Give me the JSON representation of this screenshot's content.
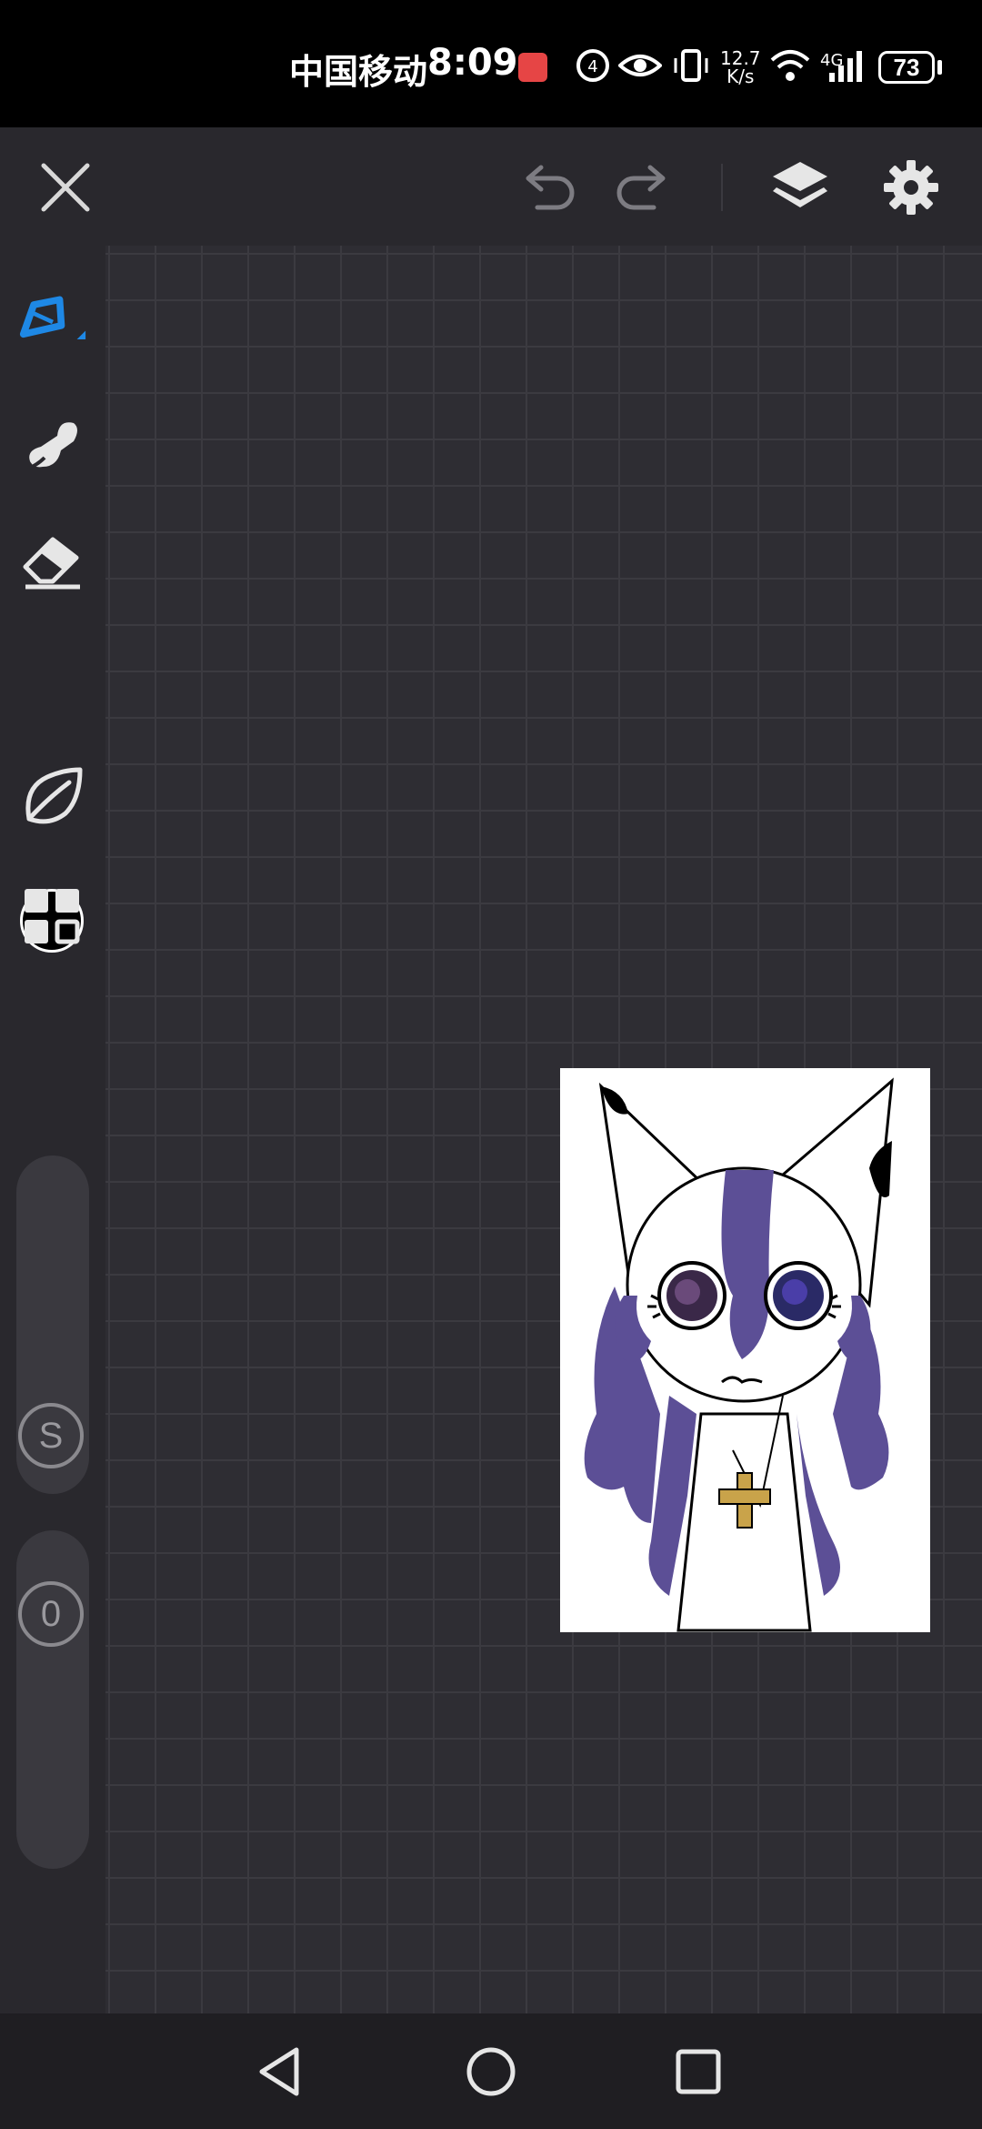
{
  "status_bar": {
    "carrier": "中国移动",
    "time": "8:09",
    "net_speed_value": "12.7",
    "net_speed_unit": "K/s",
    "network_type": "4G",
    "battery": "73"
  },
  "toolbar": {
    "icons": [
      "close-icon",
      "undo-icon",
      "redo-icon",
      "layers-icon",
      "settings-icon"
    ]
  },
  "sidebar": {
    "tools": [
      "pen-tool-icon",
      "smudge-tool-icon",
      "eraser-tool-icon",
      "color-swatch",
      "leaf-brush-icon",
      "grid-gallery-icon"
    ],
    "active_tool": "pen-tool-icon",
    "current_color": "#000000",
    "size_slider_label": "S",
    "opacity_slider_label": "0"
  },
  "colors": {
    "accent": "#1e88e5",
    "hair_purple": "#5c4f96",
    "cross_gold": "#c9a34a"
  },
  "navbar": {
    "icons": [
      "back-icon",
      "home-icon",
      "recents-icon"
    ]
  }
}
